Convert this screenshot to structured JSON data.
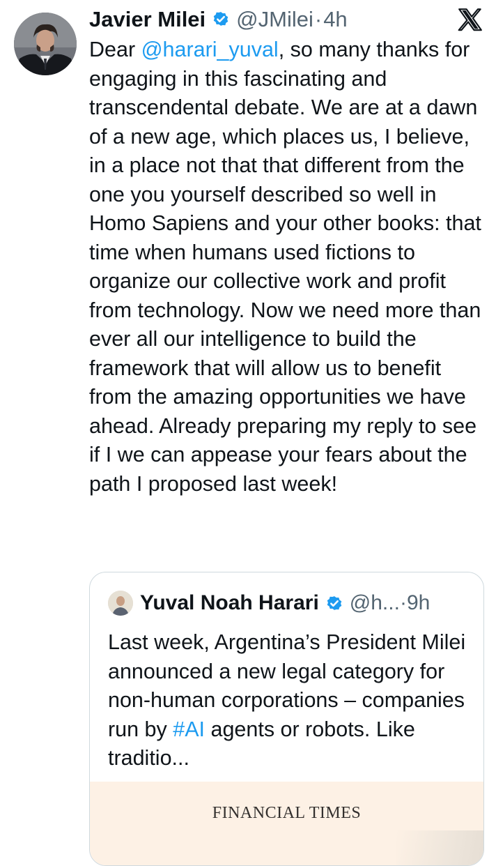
{
  "author": {
    "name": "Javier Milei",
    "handle": "@JMilei",
    "separator": "·",
    "time": "4h"
  },
  "tweet": {
    "greeting": "Dear ",
    "mention": "@harari_yuval",
    "text": ", so many thanks for engaging in this fascinating and transcendental debate. We are at a dawn of a new age, which places us, I believe, in a place not that that different from the one you yourself described so well in Homo Sapiens and your other books: that time when humans used fictions to organize our collective work and profit from technology. Now we need more than ever all our intelligence to build the framework that will allow us to benefit from the amazing opportunities we have ahead. Already preparing my reply to see if I we can appease your fears about the path I proposed last week!"
  },
  "quote": {
    "name": "Yuval Noah Harari",
    "handle": "@h...",
    "separator": "·",
    "time": "9h",
    "text_before": "Last week, Argentina’s President Milei announced a new legal category for non-human corporations – companies run by ",
    "hashtag": "#AI",
    "text_after": " agents or robots. Like traditio...",
    "media_title": "FINANCIAL TIMES"
  },
  "icons": {
    "platform": "x-logo-icon",
    "verified": "verified-badge-icon"
  },
  "colors": {
    "link": "#1d9bf0",
    "verified": "#1d9bf0",
    "muted": "#536471",
    "text": "#0f1419",
    "border": "#cfd9de",
    "media_bg": "#fdf1e5"
  }
}
